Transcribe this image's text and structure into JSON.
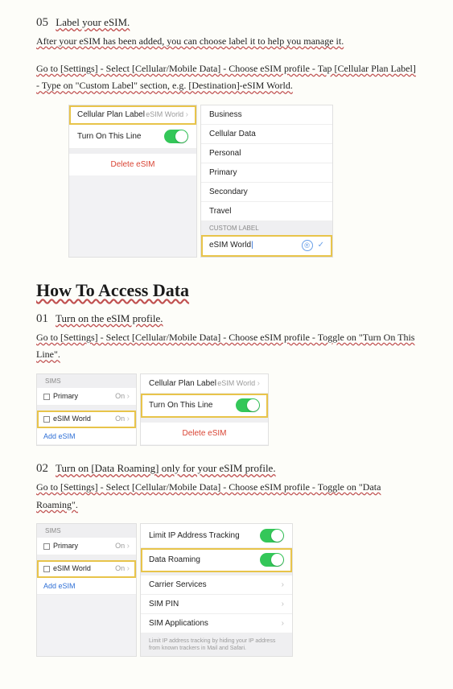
{
  "step5": {
    "num": "05",
    "title": "Label your eSIM.",
    "line1": "After your eSIM has been added, you can choose label it to help you manage it.",
    "line2": "Go to [Settings] - Select [Cellular/Mobile Data] - Choose eSIM profile - Tap [Cellular Plan Label] - Type on \"Custom Label\" section, e.g. [Destination]-eSIM World."
  },
  "mock1": {
    "plan_label": "Cellular Plan Label",
    "plan_value": "eSIM World",
    "turn_on": "Turn On This Line",
    "delete": "Delete eSIM",
    "options": [
      "Business",
      "Cellular Data",
      "Personal",
      "Primary",
      "Secondary",
      "Travel"
    ],
    "custom_header": "CUSTOM LABEL",
    "custom_value": "eSIM World",
    "check": "✓"
  },
  "heading": "How To Access Data",
  "step1": {
    "num": "01",
    "title": "Turn on the eSIM profile.",
    "line": "Go to [Settings] - Select [Cellular/Mobile Data] - Choose eSIM profile - Toggle on \"Turn On This Line\"."
  },
  "sims": {
    "header": "SIMs",
    "primary": "Primary",
    "on": "On",
    "esim": "eSIM World",
    "add": "Add eSIM"
  },
  "mock2": {
    "plan_label": "Cellular Plan Label",
    "plan_value": "eSIM World",
    "turn_on": "Turn On This Line",
    "delete": "Delete eSIM"
  },
  "step2": {
    "num": "02",
    "title": "Turn on [Data Roaming] only for your eSIM profile.",
    "line": "Go to [Settings] - Select [Cellular/Mobile Data] - Choose eSIM profile - Toggle on \"Data Roaming\"."
  },
  "mock3": {
    "limit_ip": "Limit IP Address Tracking",
    "roaming": "Data Roaming",
    "carrier": "Carrier Services",
    "simpin": "SIM PIN",
    "simapps": "SIM Applications",
    "foot": "Limit IP address tracking by hiding your IP address from known trackers in Mail and Safari."
  }
}
